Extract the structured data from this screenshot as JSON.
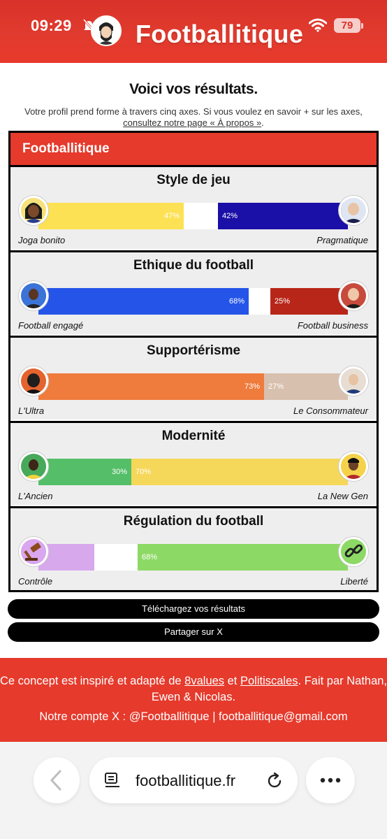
{
  "status_bar": {
    "time": "09:29",
    "battery": "79"
  },
  "header": {
    "brand": "Footballitique"
  },
  "intro": {
    "title": "Voici vos résultats.",
    "text": "Votre profil prend forme à travers cinq axes. Si vous voulez en savoir + sur les axes,",
    "link": "consultez notre page « À propos »",
    "link_suffix": "."
  },
  "card": {
    "header": "Footballitique",
    "axes": [
      {
        "title": "Style de jeu",
        "left_label": "Joga bonito",
        "right_label": "Pragmatique",
        "left_pct": "47%",
        "right_pct": "42%",
        "left_value": 47,
        "right_value": 42,
        "left_color": "#fde154",
        "right_color": "#1a0fa6"
      },
      {
        "title": "Ethique du football",
        "left_label": "Football engagé",
        "right_label": "Football business",
        "left_pct": "68%",
        "right_pct": "25%",
        "left_value": 68,
        "right_value": 25,
        "left_color": "#2554e8",
        "right_color": "#b82619"
      },
      {
        "title": "Supportérisme",
        "left_label": "L'Ultra",
        "right_label": "Le Consommateur",
        "left_pct": "73%",
        "right_pct": "27%",
        "left_value": 73,
        "right_value": 27,
        "left_color": "#ef7b3c",
        "right_color": "#d8c0ae"
      },
      {
        "title": "Modernité",
        "left_label": "L'Ancien",
        "right_label": "La New Gen",
        "left_pct": "30%",
        "right_pct": "70%",
        "left_value": 30,
        "right_value": 70,
        "left_color": "#54be68",
        "right_color": "#f5d75a"
      },
      {
        "title": "Régulation du football",
        "left_label": "Contrôle",
        "right_label": "Liberté",
        "left_pct": "",
        "right_pct": "68%",
        "left_value": 18,
        "right_value": 68,
        "left_color": "#d7a8ec",
        "right_color": "#8dd966"
      }
    ]
  },
  "buttons": {
    "download": "Téléchargez vos résultats",
    "share": "Partager sur X"
  },
  "footer": {
    "line1_a": "Ce concept est inspiré et adapté de ",
    "link1": "8values",
    "line1_b": " et ",
    "link2": "Politiscales",
    "line1_c": ". Fait par Nathan, Ewen & Nicolas.",
    "line2": "Notre compte X : @Footballitique | footballitique@gmail.com"
  },
  "browser": {
    "url": "footballitique.fr"
  },
  "icons": {
    "back": "chevron-left-icon",
    "reader": "reader-icon",
    "reload": "reload-icon",
    "more": "more-icon",
    "wifi": "wifi-icon",
    "bell": "bell-slash-icon"
  }
}
